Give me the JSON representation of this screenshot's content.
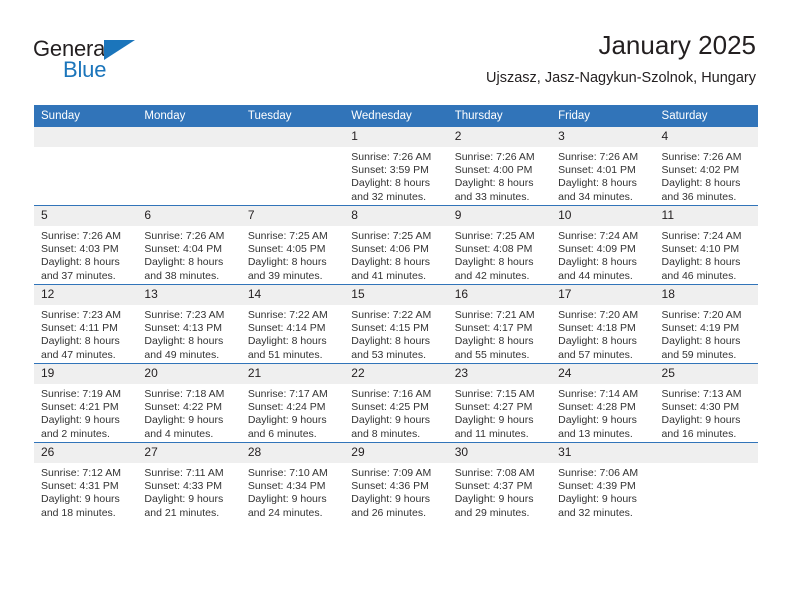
{
  "brand": {
    "name_part1": "General",
    "name_part2": "Blue",
    "triangle_icon": "blue-triangle-icon",
    "accent_color": "#1b75bb"
  },
  "header": {
    "title": "January 2025",
    "subtitle": "Ujszasz, Jasz-Nagykun-Szolnok, Hungary"
  },
  "theme": {
    "header_blue": "#3174b9",
    "daynum_gray": "#efefef",
    "text": "#231f20"
  },
  "weekday_headers": [
    "Sunday",
    "Monday",
    "Tuesday",
    "Wednesday",
    "Thursday",
    "Friday",
    "Saturday"
  ],
  "weeks": [
    [
      {
        "day": "",
        "lines": []
      },
      {
        "day": "",
        "lines": []
      },
      {
        "day": "",
        "lines": []
      },
      {
        "day": "1",
        "lines": [
          "Sunrise: 7:26 AM",
          "Sunset: 3:59 PM",
          "Daylight: 8 hours",
          "and 32 minutes."
        ]
      },
      {
        "day": "2",
        "lines": [
          "Sunrise: 7:26 AM",
          "Sunset: 4:00 PM",
          "Daylight: 8 hours",
          "and 33 minutes."
        ]
      },
      {
        "day": "3",
        "lines": [
          "Sunrise: 7:26 AM",
          "Sunset: 4:01 PM",
          "Daylight: 8 hours",
          "and 34 minutes."
        ]
      },
      {
        "day": "4",
        "lines": [
          "Sunrise: 7:26 AM",
          "Sunset: 4:02 PM",
          "Daylight: 8 hours",
          "and 36 minutes."
        ]
      }
    ],
    [
      {
        "day": "5",
        "lines": [
          "Sunrise: 7:26 AM",
          "Sunset: 4:03 PM",
          "Daylight: 8 hours",
          "and 37 minutes."
        ]
      },
      {
        "day": "6",
        "lines": [
          "Sunrise: 7:26 AM",
          "Sunset: 4:04 PM",
          "Daylight: 8 hours",
          "and 38 minutes."
        ]
      },
      {
        "day": "7",
        "lines": [
          "Sunrise: 7:25 AM",
          "Sunset: 4:05 PM",
          "Daylight: 8 hours",
          "and 39 minutes."
        ]
      },
      {
        "day": "8",
        "lines": [
          "Sunrise: 7:25 AM",
          "Sunset: 4:06 PM",
          "Daylight: 8 hours",
          "and 41 minutes."
        ]
      },
      {
        "day": "9",
        "lines": [
          "Sunrise: 7:25 AM",
          "Sunset: 4:08 PM",
          "Daylight: 8 hours",
          "and 42 minutes."
        ]
      },
      {
        "day": "10",
        "lines": [
          "Sunrise: 7:24 AM",
          "Sunset: 4:09 PM",
          "Daylight: 8 hours",
          "and 44 minutes."
        ]
      },
      {
        "day": "11",
        "lines": [
          "Sunrise: 7:24 AM",
          "Sunset: 4:10 PM",
          "Daylight: 8 hours",
          "and 46 minutes."
        ]
      }
    ],
    [
      {
        "day": "12",
        "lines": [
          "Sunrise: 7:23 AM",
          "Sunset: 4:11 PM",
          "Daylight: 8 hours",
          "and 47 minutes."
        ]
      },
      {
        "day": "13",
        "lines": [
          "Sunrise: 7:23 AM",
          "Sunset: 4:13 PM",
          "Daylight: 8 hours",
          "and 49 minutes."
        ]
      },
      {
        "day": "14",
        "lines": [
          "Sunrise: 7:22 AM",
          "Sunset: 4:14 PM",
          "Daylight: 8 hours",
          "and 51 minutes."
        ]
      },
      {
        "day": "15",
        "lines": [
          "Sunrise: 7:22 AM",
          "Sunset: 4:15 PM",
          "Daylight: 8 hours",
          "and 53 minutes."
        ]
      },
      {
        "day": "16",
        "lines": [
          "Sunrise: 7:21 AM",
          "Sunset: 4:17 PM",
          "Daylight: 8 hours",
          "and 55 minutes."
        ]
      },
      {
        "day": "17",
        "lines": [
          "Sunrise: 7:20 AM",
          "Sunset: 4:18 PM",
          "Daylight: 8 hours",
          "and 57 minutes."
        ]
      },
      {
        "day": "18",
        "lines": [
          "Sunrise: 7:20 AM",
          "Sunset: 4:19 PM",
          "Daylight: 8 hours",
          "and 59 minutes."
        ]
      }
    ],
    [
      {
        "day": "19",
        "lines": [
          "Sunrise: 7:19 AM",
          "Sunset: 4:21 PM",
          "Daylight: 9 hours",
          "and 2 minutes."
        ]
      },
      {
        "day": "20",
        "lines": [
          "Sunrise: 7:18 AM",
          "Sunset: 4:22 PM",
          "Daylight: 9 hours",
          "and 4 minutes."
        ]
      },
      {
        "day": "21",
        "lines": [
          "Sunrise: 7:17 AM",
          "Sunset: 4:24 PM",
          "Daylight: 9 hours",
          "and 6 minutes."
        ]
      },
      {
        "day": "22",
        "lines": [
          "Sunrise: 7:16 AM",
          "Sunset: 4:25 PM",
          "Daylight: 9 hours",
          "and 8 minutes."
        ]
      },
      {
        "day": "23",
        "lines": [
          "Sunrise: 7:15 AM",
          "Sunset: 4:27 PM",
          "Daylight: 9 hours",
          "and 11 minutes."
        ]
      },
      {
        "day": "24",
        "lines": [
          "Sunrise: 7:14 AM",
          "Sunset: 4:28 PM",
          "Daylight: 9 hours",
          "and 13 minutes."
        ]
      },
      {
        "day": "25",
        "lines": [
          "Sunrise: 7:13 AM",
          "Sunset: 4:30 PM",
          "Daylight: 9 hours",
          "and 16 minutes."
        ]
      }
    ],
    [
      {
        "day": "26",
        "lines": [
          "Sunrise: 7:12 AM",
          "Sunset: 4:31 PM",
          "Daylight: 9 hours",
          "and 18 minutes."
        ]
      },
      {
        "day": "27",
        "lines": [
          "Sunrise: 7:11 AM",
          "Sunset: 4:33 PM",
          "Daylight: 9 hours",
          "and 21 minutes."
        ]
      },
      {
        "day": "28",
        "lines": [
          "Sunrise: 7:10 AM",
          "Sunset: 4:34 PM",
          "Daylight: 9 hours",
          "and 24 minutes."
        ]
      },
      {
        "day": "29",
        "lines": [
          "Sunrise: 7:09 AM",
          "Sunset: 4:36 PM",
          "Daylight: 9 hours",
          "and 26 minutes."
        ]
      },
      {
        "day": "30",
        "lines": [
          "Sunrise: 7:08 AM",
          "Sunset: 4:37 PM",
          "Daylight: 9 hours",
          "and 29 minutes."
        ]
      },
      {
        "day": "31",
        "lines": [
          "Sunrise: 7:06 AM",
          "Sunset: 4:39 PM",
          "Daylight: 9 hours",
          "and 32 minutes."
        ]
      },
      {
        "day": "",
        "lines": []
      }
    ]
  ]
}
